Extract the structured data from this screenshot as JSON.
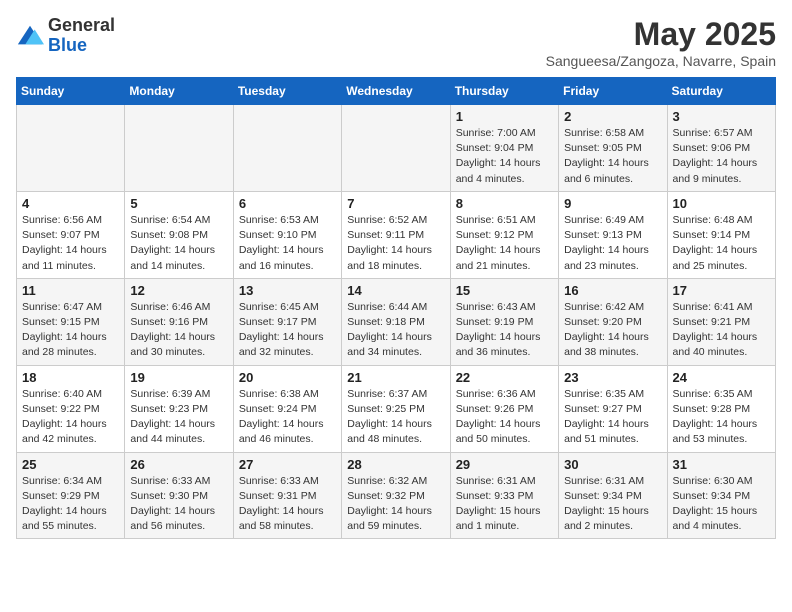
{
  "header": {
    "logo_general": "General",
    "logo_blue": "Blue",
    "month_title": "May 2025",
    "subtitle": "Sangueesa/Zangoza, Navarre, Spain"
  },
  "days_of_week": [
    "Sunday",
    "Monday",
    "Tuesday",
    "Wednesday",
    "Thursday",
    "Friday",
    "Saturday"
  ],
  "weeks": [
    [
      {
        "day": "",
        "info": ""
      },
      {
        "day": "",
        "info": ""
      },
      {
        "day": "",
        "info": ""
      },
      {
        "day": "",
        "info": ""
      },
      {
        "day": "1",
        "info": "Sunrise: 7:00 AM\nSunset: 9:04 PM\nDaylight: 14 hours\nand 4 minutes."
      },
      {
        "day": "2",
        "info": "Sunrise: 6:58 AM\nSunset: 9:05 PM\nDaylight: 14 hours\nand 6 minutes."
      },
      {
        "day": "3",
        "info": "Sunrise: 6:57 AM\nSunset: 9:06 PM\nDaylight: 14 hours\nand 9 minutes."
      }
    ],
    [
      {
        "day": "4",
        "info": "Sunrise: 6:56 AM\nSunset: 9:07 PM\nDaylight: 14 hours\nand 11 minutes."
      },
      {
        "day": "5",
        "info": "Sunrise: 6:54 AM\nSunset: 9:08 PM\nDaylight: 14 hours\nand 14 minutes."
      },
      {
        "day": "6",
        "info": "Sunrise: 6:53 AM\nSunset: 9:10 PM\nDaylight: 14 hours\nand 16 minutes."
      },
      {
        "day": "7",
        "info": "Sunrise: 6:52 AM\nSunset: 9:11 PM\nDaylight: 14 hours\nand 18 minutes."
      },
      {
        "day": "8",
        "info": "Sunrise: 6:51 AM\nSunset: 9:12 PM\nDaylight: 14 hours\nand 21 minutes."
      },
      {
        "day": "9",
        "info": "Sunrise: 6:49 AM\nSunset: 9:13 PM\nDaylight: 14 hours\nand 23 minutes."
      },
      {
        "day": "10",
        "info": "Sunrise: 6:48 AM\nSunset: 9:14 PM\nDaylight: 14 hours\nand 25 minutes."
      }
    ],
    [
      {
        "day": "11",
        "info": "Sunrise: 6:47 AM\nSunset: 9:15 PM\nDaylight: 14 hours\nand 28 minutes."
      },
      {
        "day": "12",
        "info": "Sunrise: 6:46 AM\nSunset: 9:16 PM\nDaylight: 14 hours\nand 30 minutes."
      },
      {
        "day": "13",
        "info": "Sunrise: 6:45 AM\nSunset: 9:17 PM\nDaylight: 14 hours\nand 32 minutes."
      },
      {
        "day": "14",
        "info": "Sunrise: 6:44 AM\nSunset: 9:18 PM\nDaylight: 14 hours\nand 34 minutes."
      },
      {
        "day": "15",
        "info": "Sunrise: 6:43 AM\nSunset: 9:19 PM\nDaylight: 14 hours\nand 36 minutes."
      },
      {
        "day": "16",
        "info": "Sunrise: 6:42 AM\nSunset: 9:20 PM\nDaylight: 14 hours\nand 38 minutes."
      },
      {
        "day": "17",
        "info": "Sunrise: 6:41 AM\nSunset: 9:21 PM\nDaylight: 14 hours\nand 40 minutes."
      }
    ],
    [
      {
        "day": "18",
        "info": "Sunrise: 6:40 AM\nSunset: 9:22 PM\nDaylight: 14 hours\nand 42 minutes."
      },
      {
        "day": "19",
        "info": "Sunrise: 6:39 AM\nSunset: 9:23 PM\nDaylight: 14 hours\nand 44 minutes."
      },
      {
        "day": "20",
        "info": "Sunrise: 6:38 AM\nSunset: 9:24 PM\nDaylight: 14 hours\nand 46 minutes."
      },
      {
        "day": "21",
        "info": "Sunrise: 6:37 AM\nSunset: 9:25 PM\nDaylight: 14 hours\nand 48 minutes."
      },
      {
        "day": "22",
        "info": "Sunrise: 6:36 AM\nSunset: 9:26 PM\nDaylight: 14 hours\nand 50 minutes."
      },
      {
        "day": "23",
        "info": "Sunrise: 6:35 AM\nSunset: 9:27 PM\nDaylight: 14 hours\nand 51 minutes."
      },
      {
        "day": "24",
        "info": "Sunrise: 6:35 AM\nSunset: 9:28 PM\nDaylight: 14 hours\nand 53 minutes."
      }
    ],
    [
      {
        "day": "25",
        "info": "Sunrise: 6:34 AM\nSunset: 9:29 PM\nDaylight: 14 hours\nand 55 minutes."
      },
      {
        "day": "26",
        "info": "Sunrise: 6:33 AM\nSunset: 9:30 PM\nDaylight: 14 hours\nand 56 minutes."
      },
      {
        "day": "27",
        "info": "Sunrise: 6:33 AM\nSunset: 9:31 PM\nDaylight: 14 hours\nand 58 minutes."
      },
      {
        "day": "28",
        "info": "Sunrise: 6:32 AM\nSunset: 9:32 PM\nDaylight: 14 hours\nand 59 minutes."
      },
      {
        "day": "29",
        "info": "Sunrise: 6:31 AM\nSunset: 9:33 PM\nDaylight: 15 hours\nand 1 minute."
      },
      {
        "day": "30",
        "info": "Sunrise: 6:31 AM\nSunset: 9:34 PM\nDaylight: 15 hours\nand 2 minutes."
      },
      {
        "day": "31",
        "info": "Sunrise: 6:30 AM\nSunset: 9:34 PM\nDaylight: 15 hours\nand 4 minutes."
      }
    ]
  ]
}
